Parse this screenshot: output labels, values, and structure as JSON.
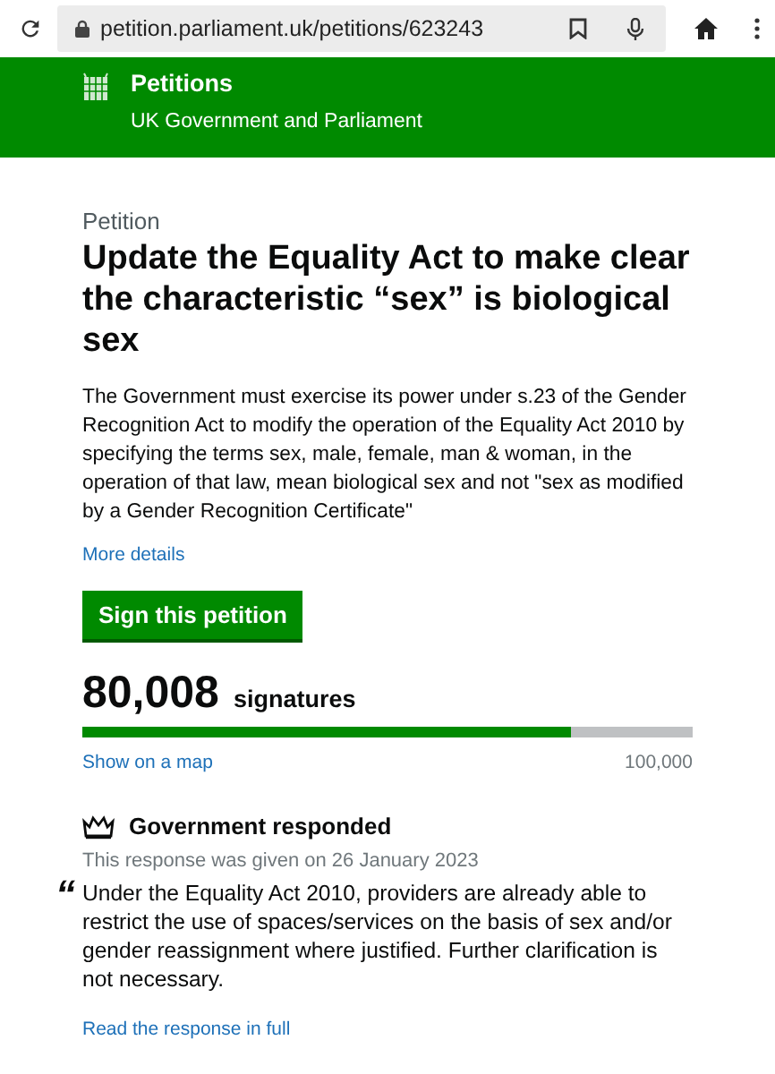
{
  "browser": {
    "url": "petition.parliament.uk/petitions/623243"
  },
  "header": {
    "title": "Petitions",
    "subtitle": "UK Government and Parliament"
  },
  "petition": {
    "label": "Petition",
    "title": "Update the Equality Act to make clear the characteristic “sex” is biological sex",
    "description": "The Government must exercise its power under s.23 of the Gender Recognition Act to modify the operation of the Equality Act 2010 by specifying the terms sex, male, female, man & woman, in the operation of that law, mean biological sex and not \"sex as modified by a Gender Recognition Certificate\"",
    "more_link": "More details",
    "sign_button": "Sign this petition"
  },
  "signatures": {
    "count": "80,008",
    "unit": "signatures",
    "level": 0.80008,
    "map_link": "Show on a map",
    "target": "100,000"
  },
  "response": {
    "heading": "Government responded",
    "date_line": "This response was given on 26 January 2023",
    "quote_mark": "“",
    "summary": "Under the Equality Act 2010, providers are already able to restrict the use of spaces/services on the basis of sex and/or gender reassignment where justified. Further clarification is not necessary.",
    "full_link": "Read the response in full"
  }
}
